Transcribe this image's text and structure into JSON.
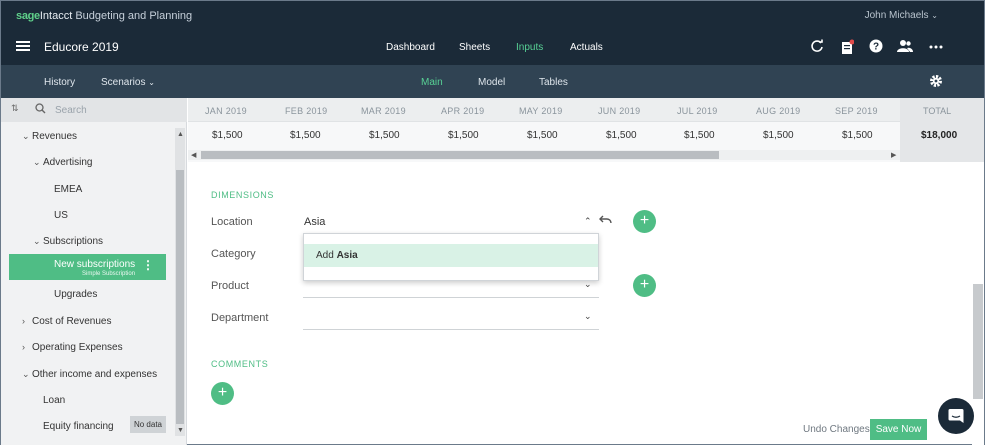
{
  "brand": {
    "sage": "sage",
    "intacct": "Intacct",
    "rest": " Budgeting and Planning"
  },
  "user": {
    "name": "John Michaels"
  },
  "app": {
    "name": "Educore 2019"
  },
  "main_nav": [
    "Dashboard",
    "Sheets",
    "Inputs",
    "Actuals"
  ],
  "main_nav_active": "Inputs",
  "sub_nav": {
    "left": [
      "History",
      "Scenarios"
    ],
    "center": [
      "Main",
      "Model",
      "Tables"
    ],
    "active": "Main"
  },
  "sidebar": {
    "search_placeholder": "Search",
    "items": [
      {
        "label": "Revenues"
      },
      {
        "label": "Advertising"
      },
      {
        "label": "EMEA"
      },
      {
        "label": "US"
      },
      {
        "label": "Subscriptions"
      },
      {
        "label": "New subscriptions",
        "sublabel": "Simple Subscription"
      },
      {
        "label": "Upgrades"
      },
      {
        "label": "Cost of Revenues"
      },
      {
        "label": "Operating Expenses"
      },
      {
        "label": "Other income and expenses"
      },
      {
        "label": "Loan"
      },
      {
        "label": "Equity financing",
        "badge": "No data"
      }
    ]
  },
  "grid": {
    "months": [
      "JAN 2019",
      "FEB 2019",
      "MAR 2019",
      "APR 2019",
      "MAY 2019",
      "JUN 2019",
      "JUL 2019",
      "AUG 2019",
      "SEP 2019"
    ],
    "values": [
      "$1,500",
      "$1,500",
      "$1,500",
      "$1,500",
      "$1,500",
      "$1,500",
      "$1,500",
      "$1,500",
      "$1,500"
    ],
    "total_label": "TOTAL",
    "total_value": "$18,000"
  },
  "form": {
    "dimensions_title": "DIMENSIONS",
    "fields": [
      {
        "label": "Location",
        "value": "Asia"
      },
      {
        "label": "Category",
        "value": ""
      },
      {
        "label": "Product",
        "value": ""
      },
      {
        "label": "Department",
        "value": ""
      }
    ],
    "dropdown": {
      "prefix": "Add ",
      "bold": "Asia"
    },
    "comments_title": "COMMENTS"
  },
  "footer": {
    "undo": "Undo Changes",
    "save": "Save Now"
  },
  "colors": {
    "accent": "#4fbd85",
    "topbar": "#1b2a38",
    "subbar": "#304353"
  }
}
